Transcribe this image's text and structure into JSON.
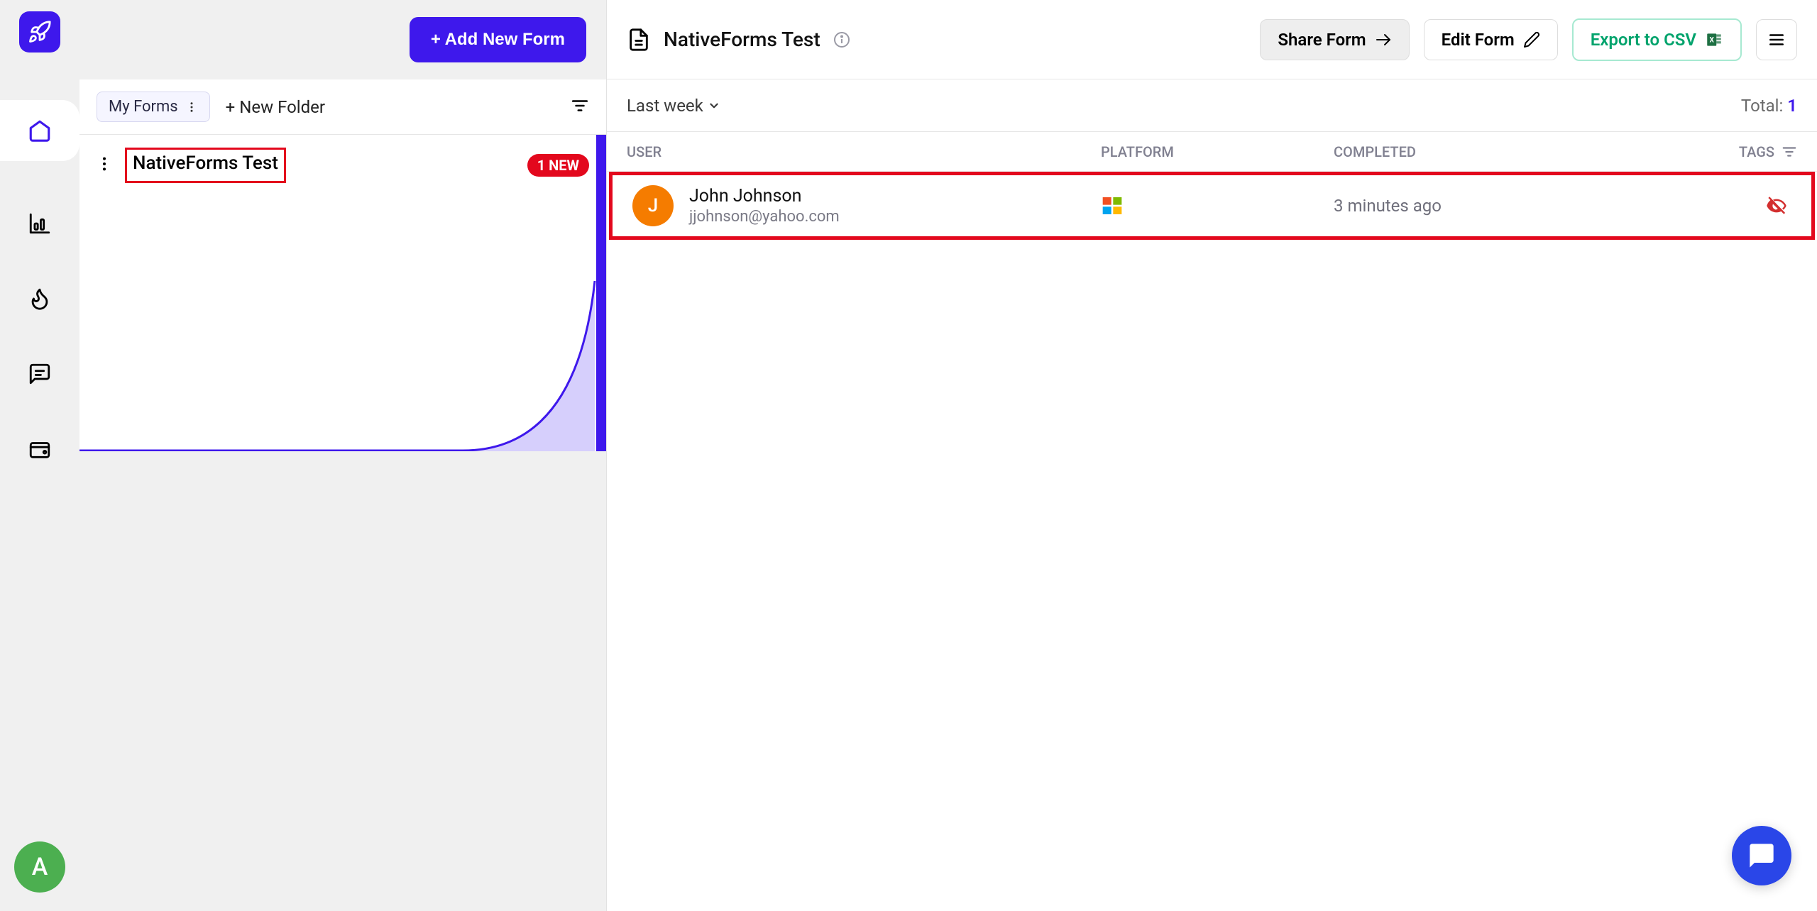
{
  "sidebar": {
    "avatar_initial": "A"
  },
  "forms_panel": {
    "add_form_label": "+ Add New Form",
    "my_forms_label": "My Forms",
    "new_folder_label": "+ New Folder",
    "selected_form": {
      "title": "NativeForms Test",
      "badge": "1 NEW"
    }
  },
  "main": {
    "form_title": "NativeForms Test",
    "share_label": "Share Form",
    "edit_label": "Edit Form",
    "export_label": "Export to CSV",
    "date_filter": "Last week",
    "total_label": "Total: ",
    "total_count": "1",
    "columns": {
      "user": "USER",
      "platform": "PLATFORM",
      "completed": "COMPLETED",
      "tags": "TAGS"
    },
    "responses": [
      {
        "initial": "J",
        "name": "John Johnson",
        "email": "jjohnson@yahoo.com",
        "completed": "3 minutes ago"
      }
    ]
  }
}
